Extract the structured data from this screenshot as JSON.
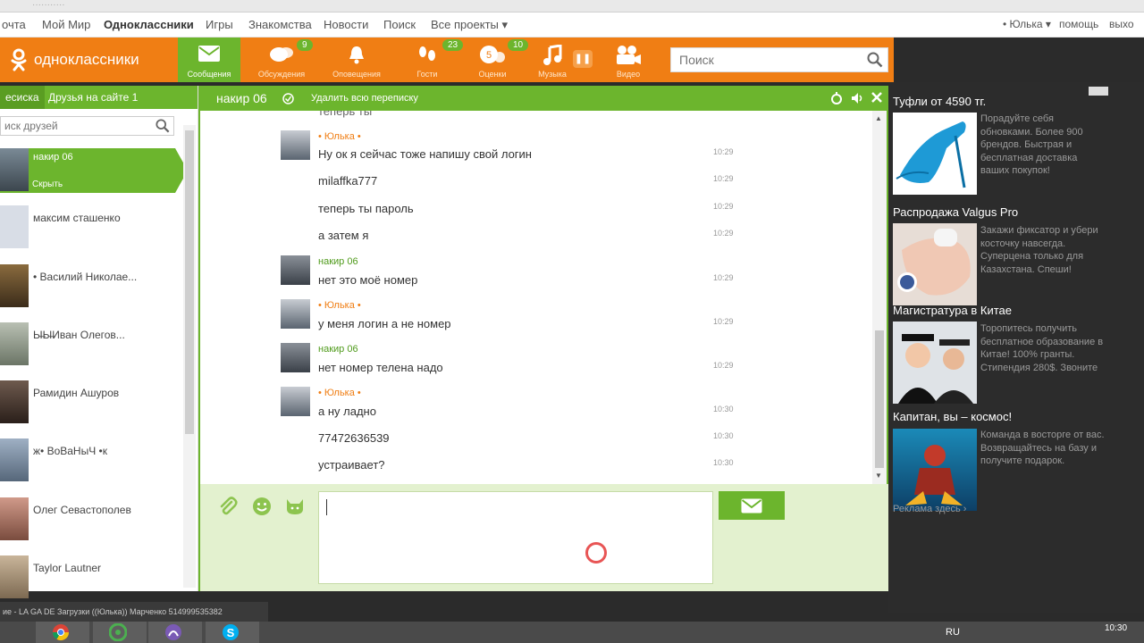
{
  "portal": {
    "items": [
      "очта",
      "Мой Мир",
      "Одноклассники",
      "Игры",
      "Знакомства",
      "Новости",
      "Поиск",
      "Все проекты ▾"
    ],
    "user": "• Юлька ▾",
    "help": "помощь",
    "logout": "выхо"
  },
  "header": {
    "logo_text": "одноклассники",
    "nav": [
      {
        "label": "Сообщения"
      },
      {
        "label": "Обсуждения",
        "badge": "9"
      },
      {
        "label": "Оповещения"
      },
      {
        "label": "Гости",
        "badge": "23"
      },
      {
        "label": "Оценки",
        "badge": "10"
      },
      {
        "label": "Музыка"
      },
      {
        "label": "Видео"
      }
    ],
    "search_placeholder": "Поиск"
  },
  "left": {
    "tab_active": "есиска",
    "tab_online": "Друзья на сайте 1",
    "search_placeholder": "иск друзей",
    "friends": [
      {
        "name": "накир 06",
        "hide": "Скрыть"
      },
      {
        "name": "максим сташенко"
      },
      {
        "name": "• Василий Николае..."
      },
      {
        "name": "Ы̶Ы̶Иван Олегов..."
      },
      {
        "name": "Рамидин Ашуров"
      },
      {
        "name": "ж• ВоВаНыЧ •к"
      },
      {
        "name": "Олег Севастополев"
      },
      {
        "name": "Taylor Lautner"
      }
    ]
  },
  "chat": {
    "title": "накир 06",
    "delete_all": "Удалить всю переписку",
    "top_cut": "теперь ты",
    "messages": [
      {
        "author": "• Юлька •",
        "text": "Ну ок я сейчас тоже напишу свой логин",
        "time": "10:29"
      },
      {
        "text": "milaffka777",
        "time": "10:29"
      },
      {
        "text": "теперь ты пароль",
        "time": "10:29"
      },
      {
        "text": "а затем я",
        "time": "10:29"
      },
      {
        "author": "накир 06",
        "text": "нет это моё номер",
        "time": "10:29"
      },
      {
        "author": "• Юлька •",
        "text": "у меня логин  а не номер",
        "time": "10:29"
      },
      {
        "author": "накир 06",
        "text": "нет номер телена надо",
        "time": "10:29"
      },
      {
        "author": "• Юлька •",
        "text": "а ну ладно",
        "time": "10:30"
      },
      {
        "text": "77472636539",
        "time": "10:30"
      },
      {
        "text": "устраивает?",
        "time": "10:30"
      }
    ]
  },
  "ads": [
    {
      "title": "Туфли от 4590 тг.",
      "text": "Порадуйте себя обновками. Более 900 брендов. Быстрая и бесплатная доставка ваших покупок!"
    },
    {
      "title": "Распродажа Valgus Pro",
      "text": "Закажи фиксатор и убери косточку навсегда. Суперцена только для Казахстана. Спеши!"
    },
    {
      "title": "Магистратура в Китае",
      "text": "Торопитесь получить бесплатное образование в Китае! 100% гранты. Стипендия 280$. Звоните"
    },
    {
      "title": "Капитан, вы – космос!",
      "text": "Команда в восторге от вас. Возвращайтесь на базу и получите подарок."
    }
  ],
  "ads_footer": "Реклама здесь ›",
  "status_strip": "ие - LA GA DE Загрузки  ((Юлька)) Марченко 514999535382",
  "tray": {
    "lang": "RU",
    "time": "10:30"
  },
  "colors": {
    "orange": "#f07e14",
    "green": "#6cb52d",
    "me_author": "#f07e14",
    "him_author": "#4e9a1a"
  },
  "icons": [
    "envelope-icon",
    "discussion-icon",
    "bell-icon",
    "footprints-icon",
    "rating-icon",
    "music-note-icon",
    "video-camera-icon",
    "search-icon",
    "paperclip-icon",
    "smiley-icon",
    "cat-sticker-icon",
    "close-icon",
    "sound-icon",
    "settings-icon"
  ]
}
